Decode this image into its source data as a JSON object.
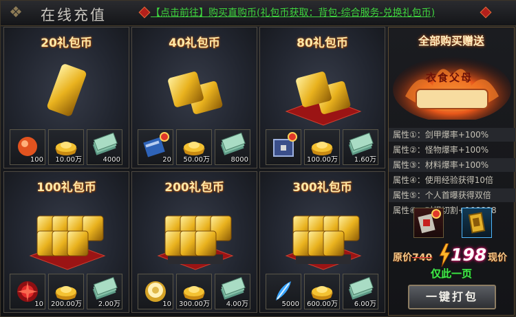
{
  "window": {
    "title": "在线充值",
    "notice": "【点击前往】购买直购币(礼包币获取：背包-综合服务-兑换礼包币)"
  },
  "packs": [
    {
      "title": "20礼包币",
      "rewards": [
        {
          "icon": "orange-orb-icon",
          "count": "100"
        },
        {
          "icon": "gold-ingot-icon",
          "count": "10.00万"
        },
        {
          "icon": "banknote-stack-icon",
          "count": "4000"
        }
      ]
    },
    {
      "title": "40礼包币",
      "rewards": [
        {
          "icon": "blue-scroll-icon",
          "count": "20"
        },
        {
          "icon": "gold-ingot-icon",
          "count": "50.00万"
        },
        {
          "icon": "banknote-stack-icon",
          "count": "8000"
        }
      ]
    },
    {
      "title": "80礼包币",
      "rewards": [
        {
          "icon": "blue-chest-icon",
          "count": ""
        },
        {
          "icon": "gold-ingot-icon",
          "count": "100.00万"
        },
        {
          "icon": "banknote-stack-icon",
          "count": "1.60万"
        }
      ]
    },
    {
      "title": "100礼包币",
      "rewards": [
        {
          "icon": "red-rune-orb-icon",
          "count": "10"
        },
        {
          "icon": "gold-ingot-icon",
          "count": "200.00万"
        },
        {
          "icon": "banknote-stack-icon",
          "count": "2.00万"
        }
      ]
    },
    {
      "title": "200礼包币",
      "rewards": [
        {
          "icon": "gold-orb-icon",
          "count": "10"
        },
        {
          "icon": "gold-ingot-icon",
          "count": "300.00万"
        },
        {
          "icon": "banknote-stack-icon",
          "count": "4.00万"
        }
      ]
    },
    {
      "title": "300礼包币",
      "rewards": [
        {
          "icon": "blue-feather-icon",
          "count": "5000"
        },
        {
          "icon": "gold-ingot-icon",
          "count": "600.00万"
        },
        {
          "icon": "banknote-stack-icon",
          "count": "6.00万"
        }
      ]
    }
  ],
  "sidebar": {
    "title": "全部购买赠送",
    "banner_text": "衣食父母",
    "attributes": [
      "属性①：剑甲爆率+100%",
      "属性②：怪物爆率+100%",
      "属性③：材料爆率+100%",
      "属性④：使用经验获得10倍",
      "属性⑤：个人首曝获得双倍",
      "属性⑥：对怪切割+108888"
    ],
    "items": [
      "red-card-icon",
      "gold-card-icon"
    ],
    "original_label": "原价",
    "original_price": "740",
    "current_price": "198",
    "current_label": "现价",
    "only_label": "仅此一页",
    "pack_button": "一键打包"
  },
  "colors": {
    "accent_gold": "#ffe9a8",
    "notice_green": "#3fd43f",
    "price_pink": "#ff2a7a"
  }
}
